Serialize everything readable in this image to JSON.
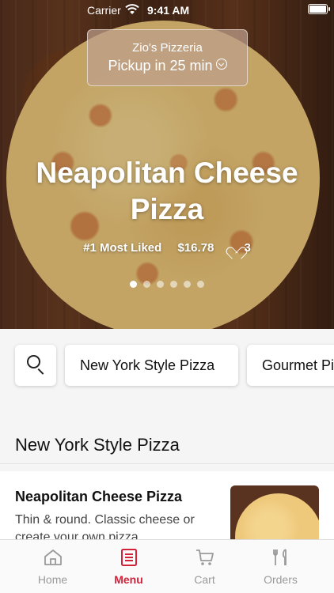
{
  "status_bar": {
    "carrier": "Carrier",
    "time": "9:41 AM"
  },
  "store": {
    "name": "Zio's Pizzeria",
    "pickup": "Pickup in 25 min"
  },
  "hero": {
    "title_line1": "Neapolitan Cheese",
    "title_line2": "Pizza",
    "badge": "#1 Most Liked",
    "price": "$16.78",
    "likes": "3",
    "page_index": 1,
    "page_count": 6
  },
  "categories": {
    "search_icon": "search-icon",
    "chips": [
      "New York Style Pizza",
      "Gourmet Pizza"
    ]
  },
  "section": {
    "title": "New York Style Pizza"
  },
  "items": [
    {
      "name": "Neapolitan Cheese Pizza",
      "description": "Thin & round. Classic cheese or create your own pizza"
    }
  ],
  "tabbar": {
    "tabs": [
      {
        "label": "Home",
        "icon": "home-icon",
        "active": false
      },
      {
        "label": "Menu",
        "icon": "menu-icon",
        "active": true
      },
      {
        "label": "Cart",
        "icon": "cart-icon",
        "active": false
      },
      {
        "label": "Orders",
        "icon": "orders-icon",
        "active": false
      }
    ]
  },
  "colors": {
    "accent": "#d2223a",
    "inactive": "#9a9a9a"
  }
}
